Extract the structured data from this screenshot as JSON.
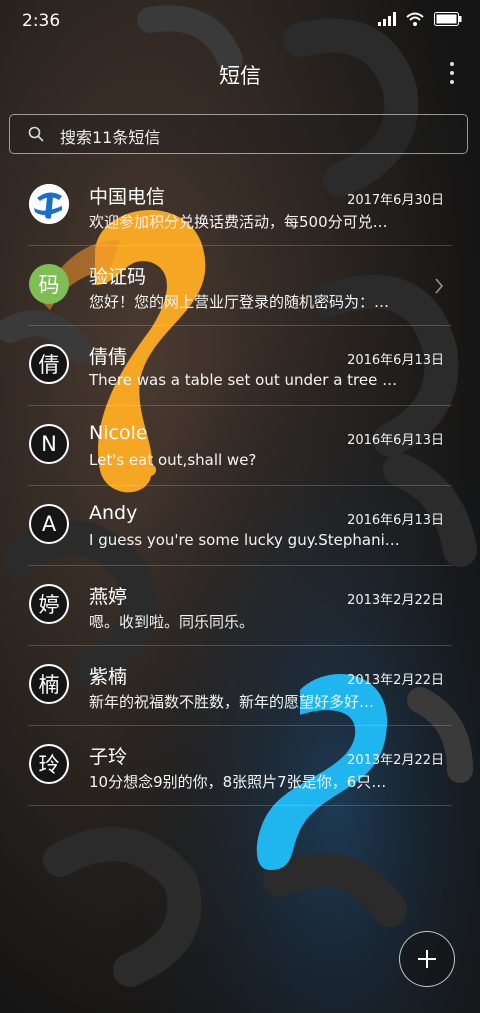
{
  "status_bar": {
    "time": "2:36",
    "icons": [
      "signal-icon",
      "wifi-icon",
      "battery-icon"
    ]
  },
  "header": {
    "title": "短信",
    "menu_icon": "more-vertical-icon"
  },
  "search": {
    "placeholder": "搜索11条短信",
    "icon": "search-icon"
  },
  "conversations": [
    {
      "name": "中国电信",
      "date": "2017年6月30日",
      "preview": "欢迎参加积分兑换话费活动，每500分可兑…",
      "avatar": "",
      "avatar_style": "telecom-logo"
    },
    {
      "name": "验证码",
      "date": "",
      "preview": "您好！您的网上营业厅登录的随机密码为：…",
      "avatar": "码",
      "avatar_style": "green"
    },
    {
      "name": "倩倩",
      "date": "2016年6月13日",
      "preview": "There was a table set out under a tree in…",
      "avatar": "倩",
      "avatar_style": "outline"
    },
    {
      "name": "Nicole",
      "date": "2016年6月13日",
      "preview": "Let's eat out,shall we?",
      "avatar": "N",
      "avatar_style": "outline"
    },
    {
      "name": "Andy",
      "date": "2016年6月13日",
      "preview": "I guess you're some lucky guy.Stephani…",
      "avatar": "A",
      "avatar_style": "outline"
    },
    {
      "name": "燕婷",
      "date": "2013年2月22日",
      "preview": "嗯。收到啦。同乐同乐。",
      "avatar": "婷",
      "avatar_style": "outline"
    },
    {
      "name": "紫楠",
      "date": "2013年2月22日",
      "preview": "新年的祝福数不胜数，新年的愿望好多好…",
      "avatar": "楠",
      "avatar_style": "outline"
    },
    {
      "name": "子玲",
      "date": "2013年2月22日",
      "preview": "10分想念9别的你，8张照片7张是你，6只…",
      "avatar": "玲",
      "avatar_style": "outline"
    }
  ],
  "fab": {
    "icon": "plus-icon"
  },
  "colors": {
    "accent_orange": "#f5a623",
    "accent_blue": "#1fb6f0",
    "avatar_green": "#7fbe54",
    "telecom_blue": "#1a6fc8"
  }
}
